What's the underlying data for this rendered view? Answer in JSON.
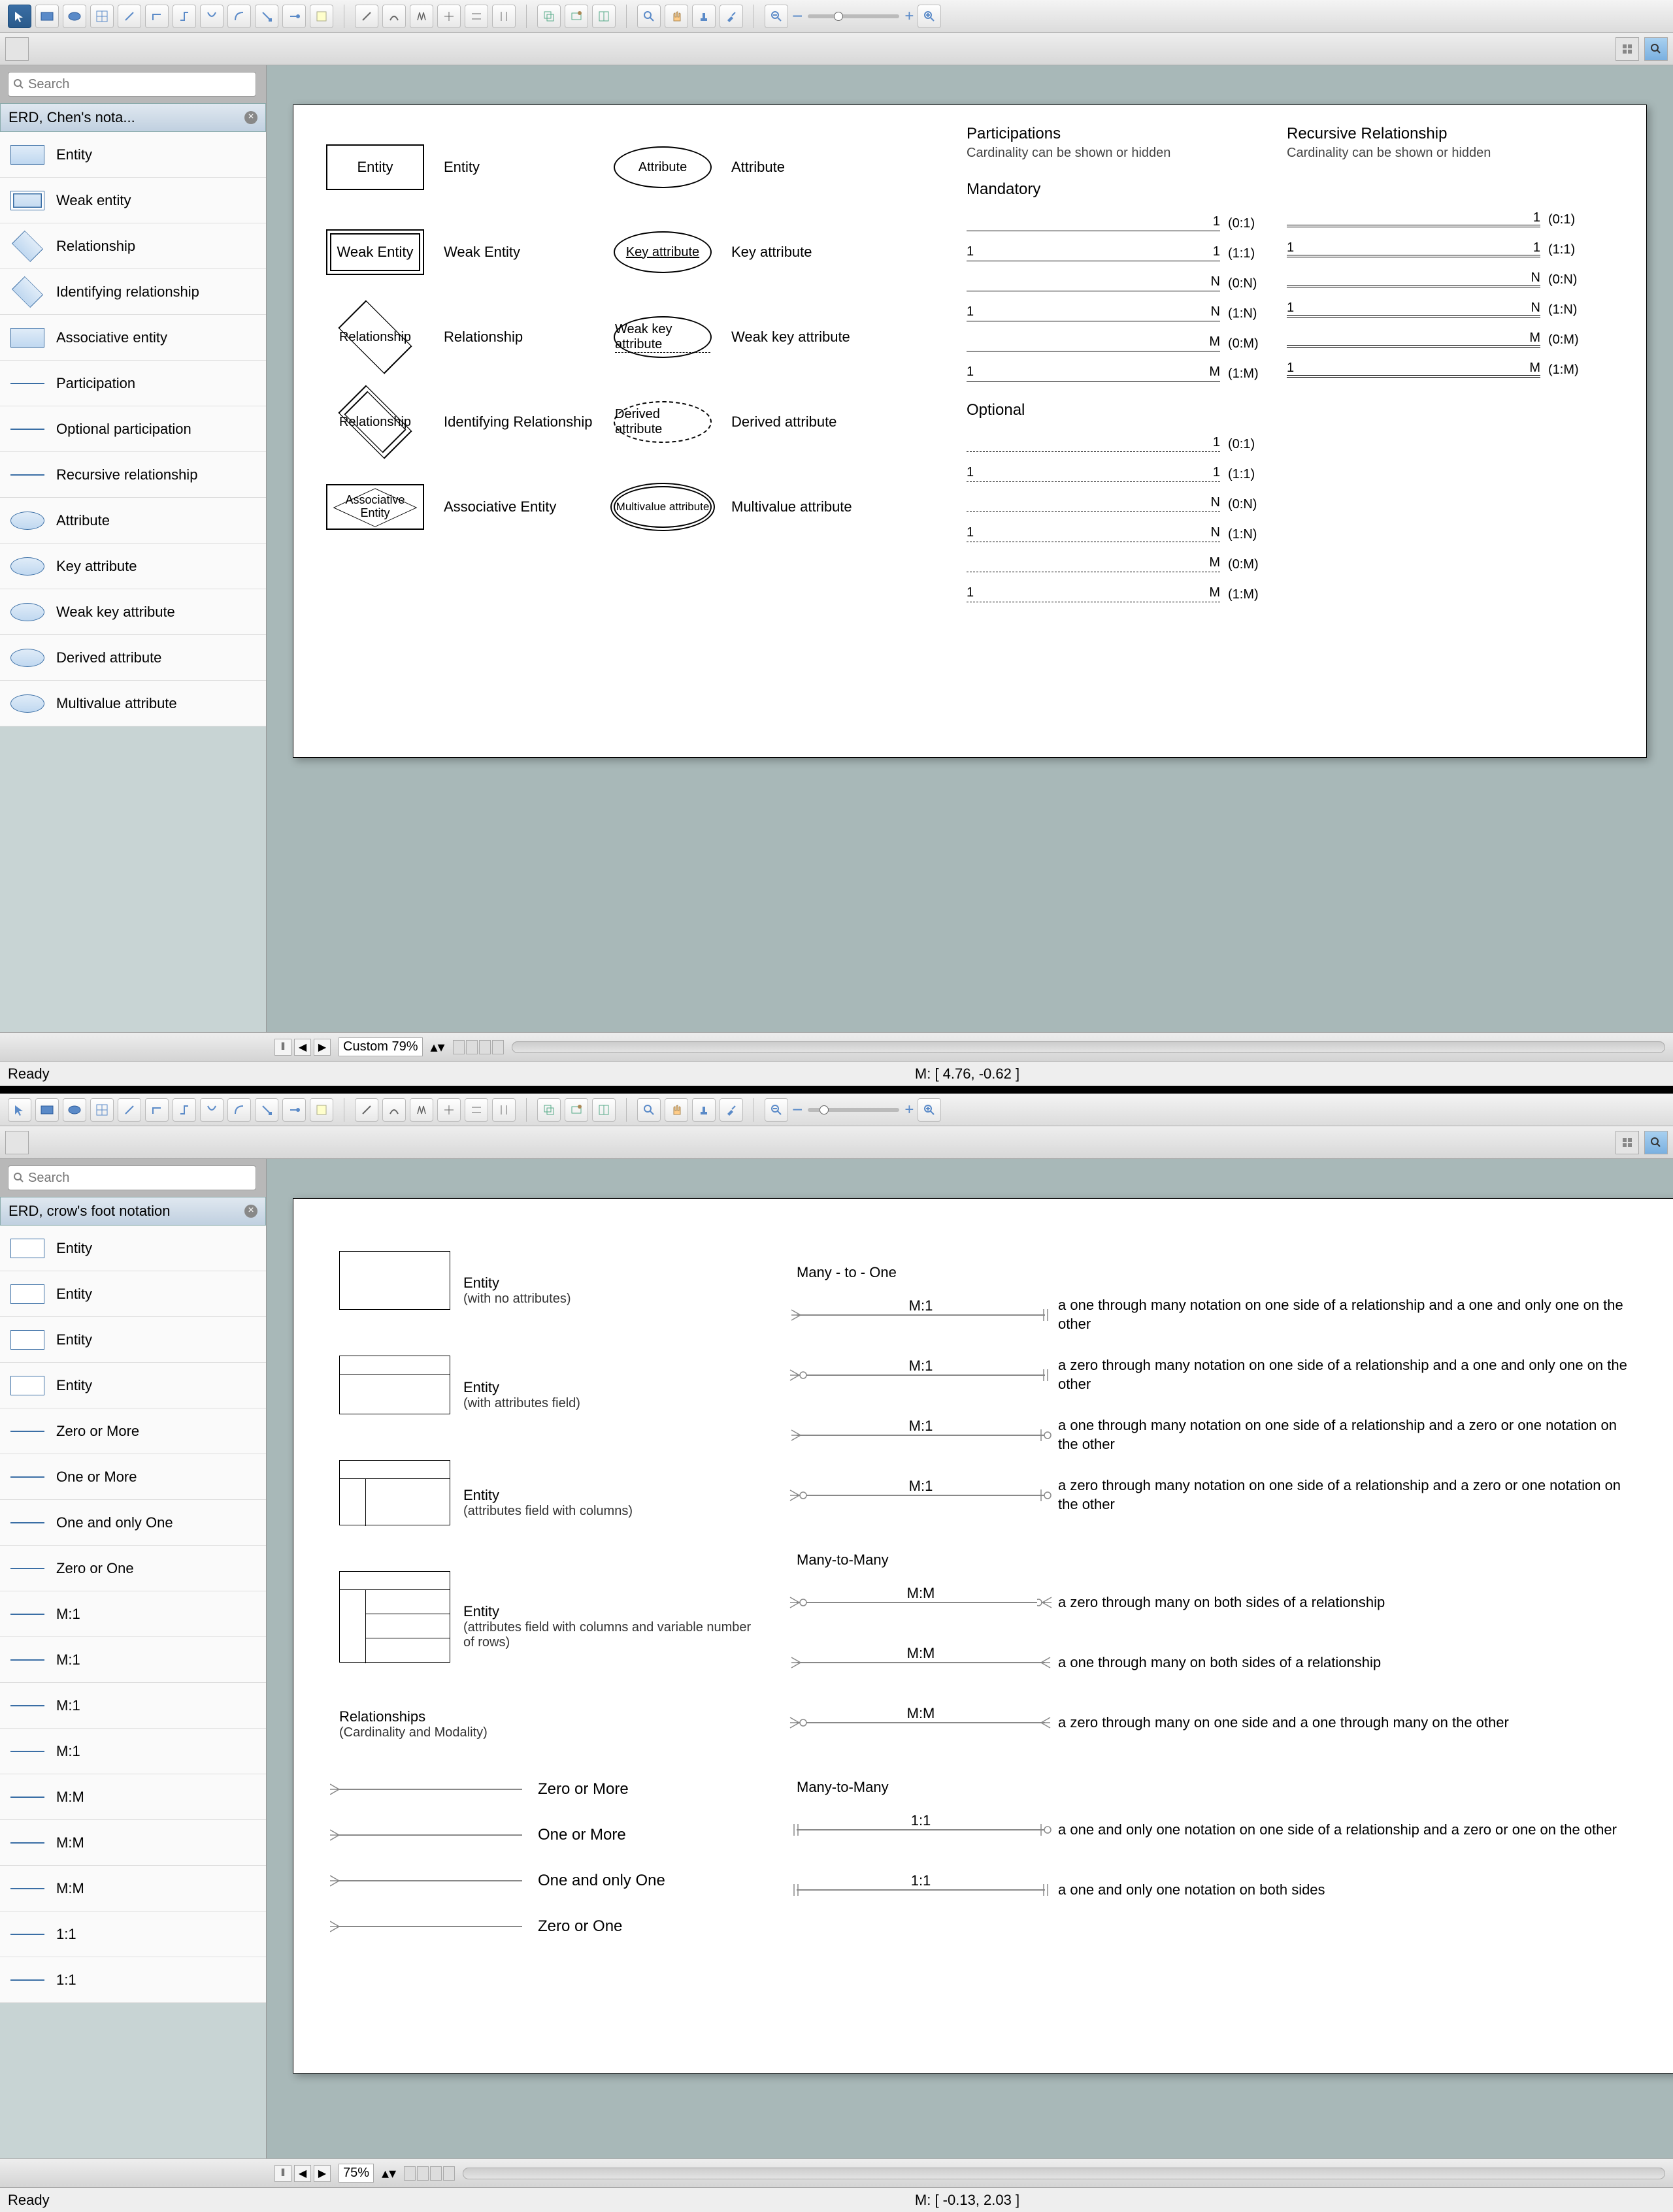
{
  "app1": {
    "search_placeholder": "Search",
    "panel_title": "ERD, Chen's nota...",
    "sidebar_items": [
      "Entity",
      "Weak entity",
      "Relationship",
      "Identifying relationship",
      "Associative entity",
      "Participation",
      "Optional participation",
      "Recursive relationship",
      "Attribute",
      "Key attribute",
      "Weak key attribute",
      "Derived attribute",
      "Multivalue attribute"
    ],
    "zoom_label": "Custom 79%",
    "status_ready": "Ready",
    "status_coords": "M: [ 4.76, -0.62 ]",
    "canvas": {
      "col1": [
        {
          "shape": "Entity",
          "label": "Entity"
        },
        {
          "shape": "Weak Entity",
          "label": "Weak Entity"
        },
        {
          "shape": "Relationship",
          "label": "Relationship"
        },
        {
          "shape": "Relationship",
          "label": "Identifying Relationship"
        },
        {
          "shape": "Associative Entity",
          "label": "Associative Entity"
        }
      ],
      "col2": [
        {
          "shape": "Attribute",
          "label": "Attribute"
        },
        {
          "shape": "Key attribute",
          "label": "Key attribute"
        },
        {
          "shape": "Weak key attribute",
          "label": "Weak key attribute"
        },
        {
          "shape": "Derived attribute",
          "label": "Derived attribute"
        },
        {
          "shape": "Multivalue attribute",
          "label": "Multivalue attribute"
        }
      ],
      "participations_title": "Participations",
      "participations_sub": "Cardinality can be shown or hidden",
      "mandatory_title": "Mandatory",
      "mandatory": [
        {
          "l": "",
          "r": "1",
          "card": "(0:1)"
        },
        {
          "l": "1",
          "r": "1",
          "card": "(1:1)"
        },
        {
          "l": "",
          "r": "N",
          "card": "(0:N)"
        },
        {
          "l": "1",
          "r": "N",
          "card": "(1:N)"
        },
        {
          "l": "",
          "r": "M",
          "card": "(0:M)"
        },
        {
          "l": "1",
          "r": "M",
          "card": "(1:M)"
        }
      ],
      "optional_title": "Optional",
      "optional": [
        {
          "l": "",
          "r": "1",
          "card": "(0:1)"
        },
        {
          "l": "1",
          "r": "1",
          "card": "(1:1)"
        },
        {
          "l": "",
          "r": "N",
          "card": "(0:N)"
        },
        {
          "l": "1",
          "r": "N",
          "card": "(1:N)"
        },
        {
          "l": "",
          "r": "M",
          "card": "(0:M)"
        },
        {
          "l": "1",
          "r": "M",
          "card": "(1:M)"
        }
      ],
      "recursive_title": "Recursive Relationship",
      "recursive_sub": "Cardinality can be shown or hidden",
      "recursive": [
        {
          "l": "",
          "r": "1",
          "card": "(0:1)"
        },
        {
          "l": "1",
          "r": "1",
          "card": "(1:1)"
        },
        {
          "l": "",
          "r": "N",
          "card": "(0:N)"
        },
        {
          "l": "1",
          "r": "N",
          "card": "(1:N)"
        },
        {
          "l": "",
          "r": "M",
          "card": "(0:M)"
        },
        {
          "l": "1",
          "r": "M",
          "card": "(1:M)"
        }
      ]
    }
  },
  "app2": {
    "search_placeholder": "Search",
    "panel_title": "ERD, crow's foot notation",
    "sidebar_items": [
      "Entity",
      "Entity",
      "Entity",
      "Entity",
      "Zero or More",
      "One or More",
      "One and only One",
      "Zero or One",
      "M:1",
      "M:1",
      "M:1",
      "M:1",
      "M:M",
      "M:M",
      "M:M",
      "1:1",
      "1:1"
    ],
    "zoom_label": "75%",
    "status_ready": "Ready",
    "status_coords": "M: [ -0.13, 2.03 ]",
    "canvas": {
      "entities": [
        {
          "title": "Entity",
          "sub": "(with no attributes)"
        },
        {
          "title": "Entity",
          "sub": "(with attributes field)"
        },
        {
          "title": "Entity",
          "sub": "(attributes field with columns)"
        },
        {
          "title": "Entity",
          "sub": "(attributes field with columns and variable number of rows)"
        }
      ],
      "relationships_title": "Relationships",
      "relationships_sub": "(Cardinality and Modality)",
      "cardinality": [
        "Zero or More",
        "One or More",
        "One and only One",
        "Zero or One"
      ],
      "sections": [
        {
          "title": "Many - to - One",
          "rows": [
            {
              "lbl": "M:1",
              "desc": "a one through many notation on one side of a relationship and a one and only one on the other"
            },
            {
              "lbl": "M:1",
              "desc": "a zero through many notation on one side of a relationship and a one and only one on the other"
            },
            {
              "lbl": "M:1",
              "desc": "a one through many notation on one side of a relationship and a zero or one notation on the other"
            },
            {
              "lbl": "M:1",
              "desc": "a zero through many notation on one side of a relationship and a zero or one notation on the other"
            }
          ]
        },
        {
          "title": "Many-to-Many",
          "rows": [
            {
              "lbl": "M:M",
              "desc": "a zero through many on both sides of a relationship"
            },
            {
              "lbl": "M:M",
              "desc": "a one through many on both sides of a relationship"
            },
            {
              "lbl": "M:M",
              "desc": "a zero through many on one side and a one through many on the other"
            }
          ]
        },
        {
          "title": "Many-to-Many",
          "rows": [
            {
              "lbl": "1:1",
              "desc": "a one and only one notation on one side of a relationship and a zero or one on the other"
            },
            {
              "lbl": "1:1",
              "desc": "a one and only one notation on both sides"
            }
          ]
        }
      ]
    }
  }
}
